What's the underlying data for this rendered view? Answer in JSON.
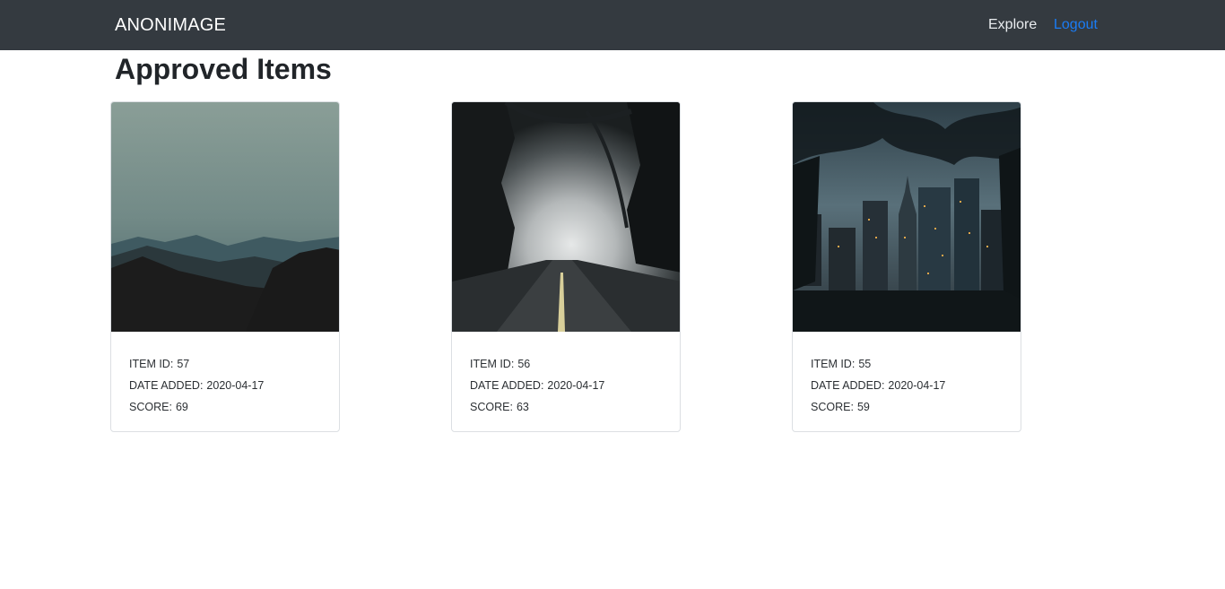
{
  "navbar": {
    "brand": "ANONIMAGE",
    "links": [
      {
        "label": "Explore",
        "color": "#e9ecef"
      },
      {
        "label": "Logout",
        "color": "#1a7cf5"
      }
    ],
    "background": "#343a40"
  },
  "page": {
    "title": "Approved Items"
  },
  "items": [
    {
      "id_label": "ITEM ID:",
      "id": "57",
      "date_label": "DATE ADDED:",
      "date": "2020-04-17",
      "score_label": "SCORE:",
      "score": "69",
      "image": "misty-mountain-landscape"
    },
    {
      "id_label": "ITEM ID:",
      "id": "56",
      "date_label": "DATE ADDED:",
      "date": "2020-04-17",
      "score_label": "SCORE:",
      "score": "63",
      "image": "foggy-forest-road"
    },
    {
      "id_label": "ITEM ID:",
      "id": "55",
      "date_label": "DATE ADDED:",
      "date": "2020-04-17",
      "score_label": "SCORE:",
      "score": "59",
      "image": "city-skyline-dusk"
    }
  ]
}
